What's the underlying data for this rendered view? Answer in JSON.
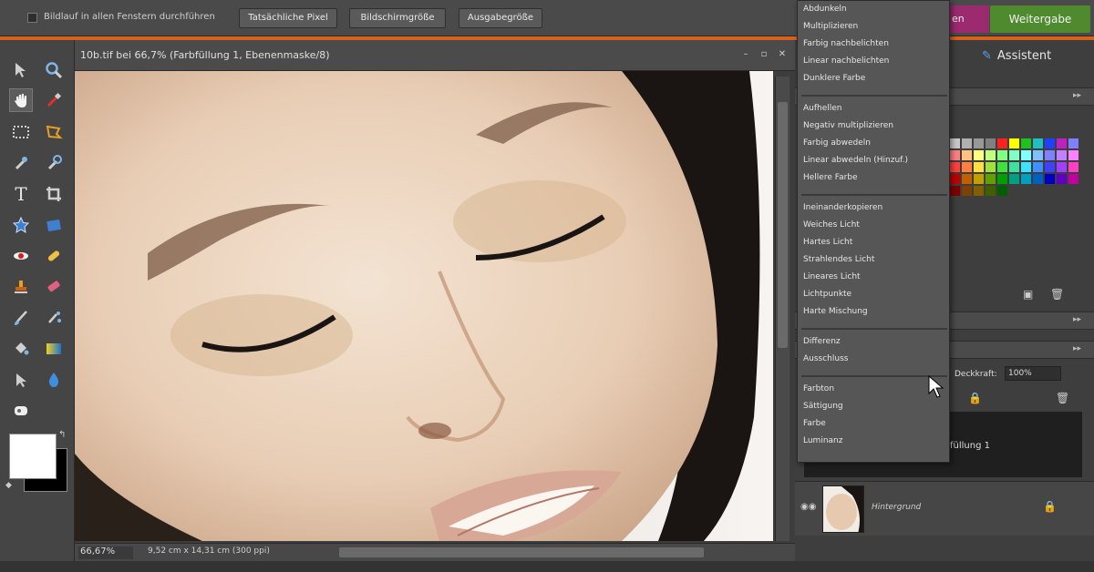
{
  "options_bar": {
    "scroll_all_label": "Bildlauf in allen Fenstern durchführen",
    "actual_pixels": "Tatsächliche Pixel",
    "fit_screen": "Bildschirmgröße",
    "print_size": "Ausgabegröße"
  },
  "mode_tabs": {
    "edit": "en",
    "share": "Weitergabe"
  },
  "document": {
    "title": "10b.tif bei 66,7% (Farbfüllung 1, Ebenenmaske/8)",
    "zoom": "66,67%",
    "dimensions": "9,52 cm x 14,31 cm (300 ppi)"
  },
  "panels": {
    "assistant": "Assistent",
    "opacity_label": "Deckkraft:",
    "opacity_value": "100%",
    "layer_partial_name": "füllung 1",
    "background_layer": "Hintergrund"
  },
  "blend_menu": {
    "groups": [
      [
        "Abdunkeln",
        "Multiplizieren",
        "Farbig nachbelichten",
        "Linear nachbelichten",
        "Dunklere Farbe"
      ],
      [
        "Aufhellen",
        "Negativ multiplizieren",
        "Farbig abwedeln",
        "Linear abwedeln (Hinzuf.)",
        "Hellere Farbe"
      ],
      [
        "Ineinanderkopieren",
        "Weiches Licht",
        "Hartes Licht",
        "Strahlendes Licht",
        "Lineares Licht",
        "Lichtpunkte",
        "Harte Mischung"
      ],
      [
        "Differenz",
        "Ausschluss"
      ],
      [
        "Farbton",
        "Sättigung",
        "Farbe",
        "Luminanz"
      ]
    ]
  },
  "colors": {
    "accent_orange": "#d9621a",
    "edit_tab": "#9b2a6f",
    "share_tab": "#4f8a2e"
  },
  "tool_icons": [
    "move-tool-icon",
    "zoom-tool-icon",
    "hand-tool-icon",
    "eyedropper-tool-icon",
    "marquee-tool-icon",
    "lasso-tool-icon",
    "magic-wand-tool-icon",
    "quick-selection-tool-icon",
    "type-tool-icon",
    "crop-tool-icon",
    "cookie-cutter-tool-icon",
    "straighten-tool-icon",
    "red-eye-tool-icon",
    "healing-brush-tool-icon",
    "clone-stamp-tool-icon",
    "eraser-tool-icon",
    "brush-tool-icon",
    "smart-brush-tool-icon",
    "paint-bucket-tool-icon",
    "gradient-tool-icon",
    "shape-tool-icon",
    "blur-tool-icon",
    "sponge-tool-icon"
  ]
}
